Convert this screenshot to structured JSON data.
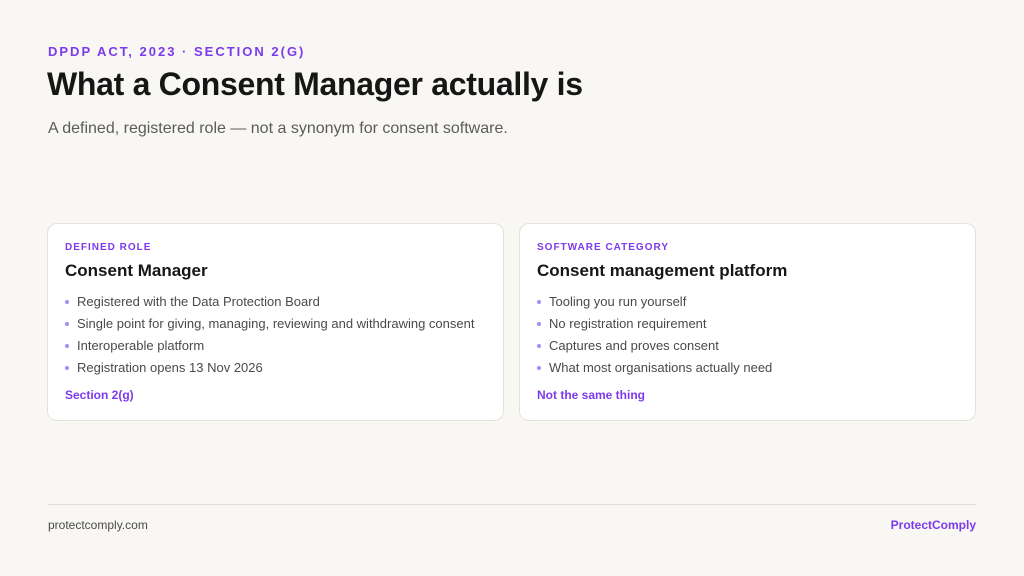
{
  "header": {
    "eyebrow": "DPDP ACT, 2023 · SECTION 2(G)",
    "title": "What a Consent Manager actually is",
    "subtitle": "A defined, registered role — not a synonym for consent software."
  },
  "cards": [
    {
      "tag": "DEFINED ROLE",
      "title": "Consent Manager",
      "items": [
        "Registered with the Data Protection Board",
        "Single point for giving, managing, reviewing and withdrawing consent",
        "Interoperable platform",
        "Registration opens 13 Nov 2026"
      ],
      "footer": "Section 2(g)"
    },
    {
      "tag": "SOFTWARE CATEGORY",
      "title": "Consent management platform",
      "items": [
        "Tooling you run yourself",
        "No registration requirement",
        "Captures and proves consent",
        "What most organisations actually need"
      ],
      "footer": "Not the same thing"
    }
  ],
  "footer": {
    "url": "protectcomply.com",
    "brand": "ProtectComply"
  },
  "colors": {
    "accent": "#7c3aed",
    "background": "#f8f7f4",
    "bullet": "#a78bfa"
  }
}
